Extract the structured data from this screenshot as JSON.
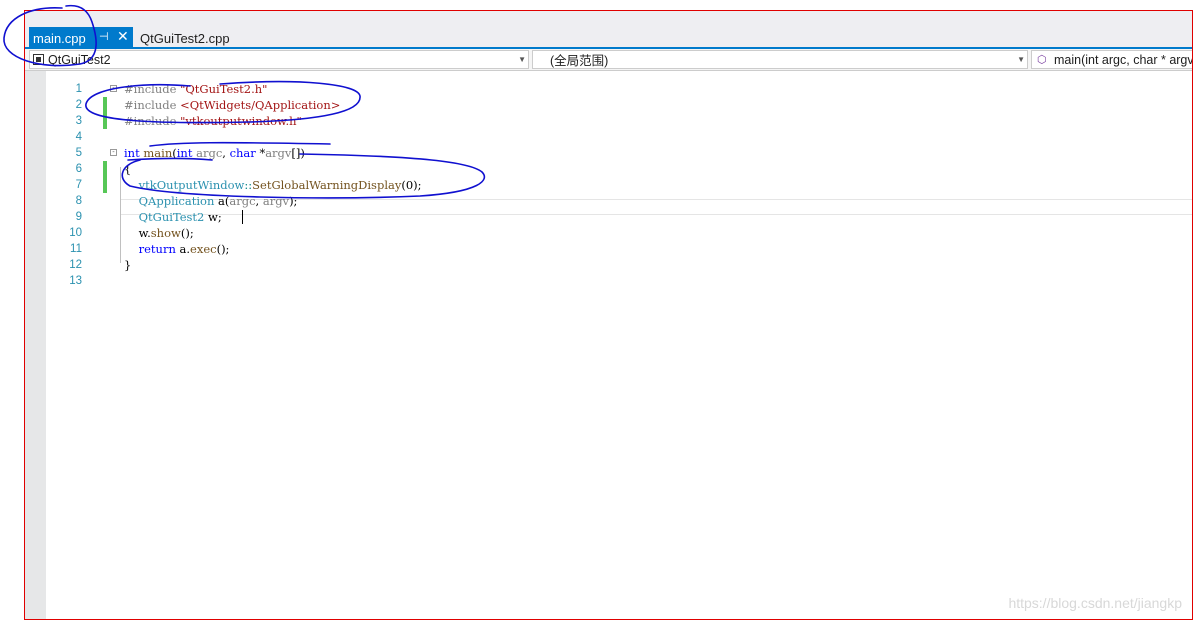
{
  "tabs": {
    "active": {
      "label": "main.cpp",
      "pin": "⊣",
      "close": "✕"
    },
    "inactive": {
      "label": "QtGuiTest2.cpp"
    }
  },
  "navbar": {
    "project": "QtGuiTest2",
    "scope": "(全局范围)",
    "member": "main(int argc, char * argv"
  },
  "code_lines": [
    {
      "n": "1",
      "parts": [
        [
          "pp",
          "#include "
        ],
        [
          "str",
          "\"QtGuiTest2.h\""
        ]
      ]
    },
    {
      "n": "2",
      "parts": [
        [
          "pp",
          "#include "
        ],
        [
          "str",
          "<QtWidgets/QApplication>"
        ]
      ]
    },
    {
      "n": "3",
      "parts": [
        [
          "pp",
          "#include "
        ],
        [
          "str",
          "\"vtkoutputwindow.h\""
        ]
      ]
    },
    {
      "n": "4",
      "parts": []
    },
    {
      "n": "5",
      "parts": [
        [
          "kw",
          "int "
        ],
        [
          "fn",
          "main"
        ],
        [
          "dt",
          "("
        ],
        [
          "kw",
          "int "
        ],
        [
          "pr",
          "argc"
        ],
        [
          "dt",
          ", "
        ],
        [
          "kw",
          "char "
        ],
        [
          "dt",
          "*"
        ],
        [
          "pr",
          "argv"
        ],
        [
          "dt",
          "[])"
        ]
      ]
    },
    {
      "n": "6",
      "parts": [
        [
          "dt",
          "{"
        ]
      ]
    },
    {
      "n": "7",
      "parts": [
        [
          "dt",
          "    "
        ],
        [
          "ty",
          "vtkOutputWindow"
        ],
        [
          "op",
          "::"
        ],
        [
          "fn",
          "SetGlobalWarningDisplay"
        ],
        [
          "dt",
          "(0);"
        ]
      ]
    },
    {
      "n": "8",
      "parts": [
        [
          "dt",
          "    "
        ],
        [
          "ty",
          "QApplication "
        ],
        [
          "dt",
          "a("
        ],
        [
          "pr",
          "argc"
        ],
        [
          "dt",
          ", "
        ],
        [
          "pr",
          "argv"
        ],
        [
          "dt",
          ");"
        ]
      ]
    },
    {
      "n": "9",
      "parts": [
        [
          "dt",
          "    "
        ],
        [
          "ty",
          "QtGuiTest2 "
        ],
        [
          "dt",
          "w;"
        ]
      ]
    },
    {
      "n": "10",
      "parts": [
        [
          "dt",
          "    w."
        ],
        [
          "fn",
          "show"
        ],
        [
          "dt",
          "();"
        ]
      ]
    },
    {
      "n": "11",
      "parts": [
        [
          "dt",
          "    "
        ],
        [
          "kw",
          "return "
        ],
        [
          "dt",
          "a."
        ],
        [
          "fn",
          "exec"
        ],
        [
          "dt",
          "();"
        ]
      ]
    },
    {
      "n": "12",
      "parts": [
        [
          "dt",
          "}"
        ]
      ]
    },
    {
      "n": "13",
      "parts": []
    }
  ],
  "watermark": "https://blog.csdn.net/jiangkp",
  "colors": {
    "accent": "#007acc",
    "frame_border": "#e00000",
    "change_bar": "#57c757",
    "annotation_ink": "#1010d0"
  }
}
